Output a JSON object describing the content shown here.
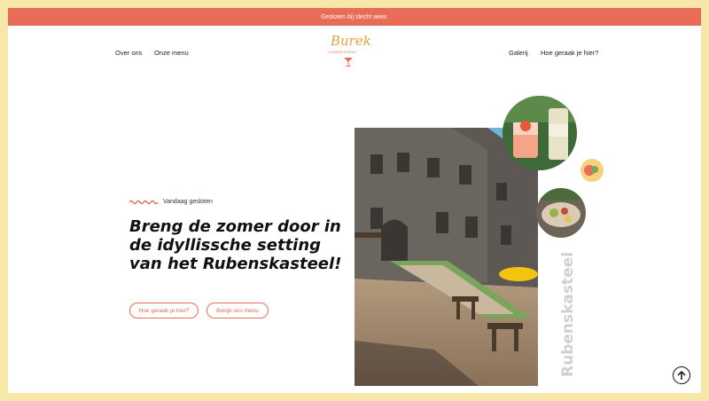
{
  "banner": {
    "text": "Gesloten bij slecht weer."
  },
  "nav": {
    "left": [
      {
        "label": "Over ons"
      },
      {
        "label": "Onze menu"
      }
    ],
    "right": [
      {
        "label": "Galerij"
      },
      {
        "label": "Hoe geraak je hier?"
      }
    ]
  },
  "logo": {
    "script": "Burek",
    "tagline": "ZOMERTERRAS"
  },
  "hero": {
    "status": "Vandaag gesloten",
    "headline": "Breng de zomer door in de idyllissche setting van het Rubenskasteel!",
    "buttons": [
      {
        "label": "Hoe geraak je hier?"
      },
      {
        "label": "Bekijk ons menu"
      }
    ],
    "vertical_label": "Rubenskasteel"
  },
  "colors": {
    "accent": "#e96c59",
    "frame": "#f7e7a8",
    "logo": "#e2a33c"
  },
  "icons": {
    "scroll_top": "arrow-up-circle-icon",
    "status": "wave-icon"
  }
}
